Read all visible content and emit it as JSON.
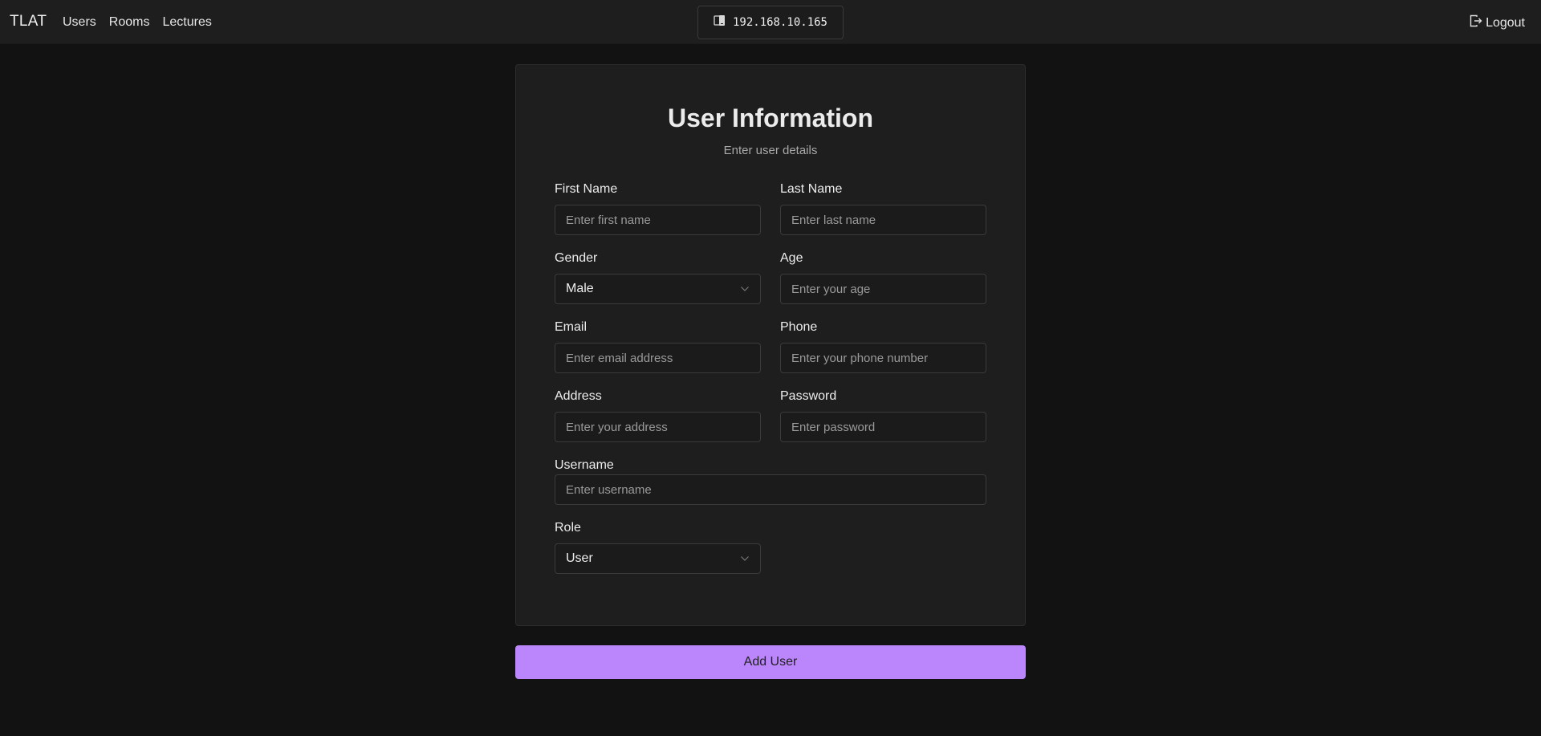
{
  "nav": {
    "brand": "TLAT",
    "links": [
      "Users",
      "Rooms",
      "Lectures"
    ],
    "ip": "192.168.10.165",
    "logout": "Logout"
  },
  "form": {
    "title": "User Information",
    "subtitle": "Enter user details",
    "first_name": {
      "label": "First Name",
      "placeholder": "Enter first name"
    },
    "last_name": {
      "label": "Last Name",
      "placeholder": "Enter last name"
    },
    "gender": {
      "label": "Gender",
      "value": "Male"
    },
    "age": {
      "label": "Age",
      "placeholder": "Enter your age"
    },
    "email": {
      "label": "Email",
      "placeholder": "Enter email address"
    },
    "phone": {
      "label": "Phone",
      "placeholder": "Enter your phone number"
    },
    "address": {
      "label": "Address",
      "placeholder": "Enter your address"
    },
    "password": {
      "label": "Password",
      "placeholder": "Enter password"
    },
    "username": {
      "label": "Username",
      "placeholder": "Enter username"
    },
    "role": {
      "label": "Role",
      "value": "User"
    },
    "submit": "Add User"
  },
  "colors": {
    "accent": "#bb86fc",
    "background": "#121212",
    "surface": "#1e1e1e"
  },
  "icons": [
    "device-icon",
    "logout-icon",
    "chevron-down-icon"
  ]
}
